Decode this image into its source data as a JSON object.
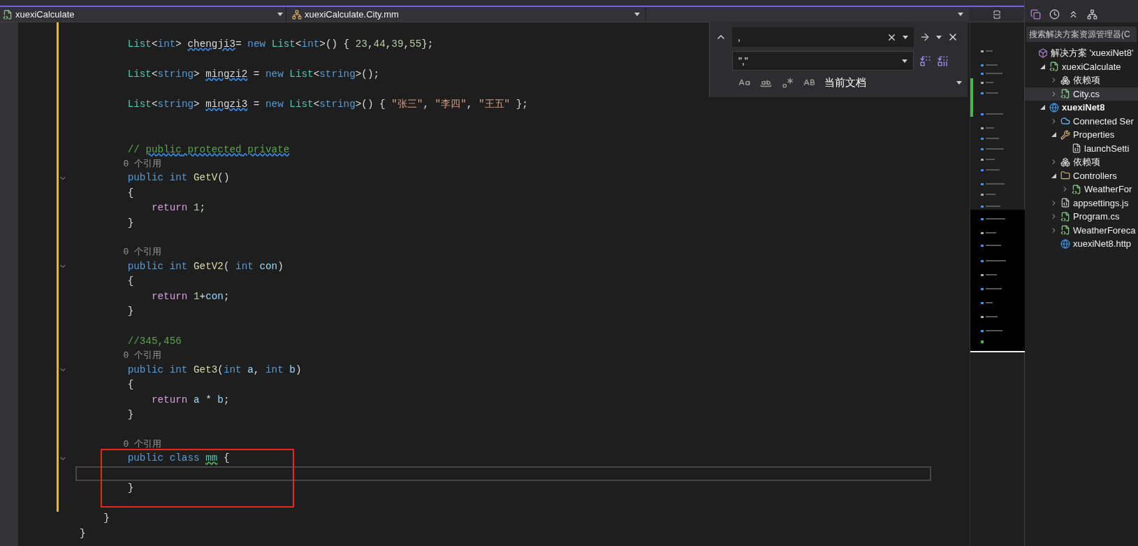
{
  "navigation_bar": {
    "project": "xuexiCalculate",
    "member": "xuexiCalculate.City.mm"
  },
  "find_widget": {
    "find_value": ",",
    "replace_value": "\",\"",
    "scope": "当前文档",
    "options": [
      {
        "kind": "match-case",
        "on": false
      },
      {
        "kind": "whole-word",
        "on": false
      },
      {
        "kind": "regex",
        "on": false
      },
      {
        "kind": "preserve-case",
        "on": false
      }
    ]
  },
  "editor": {
    "rows": [
      {
        "kind": "code",
        "tokens": [
          {
            "text": "        List",
            "kind": "type"
          },
          {
            "text": "<",
            "kind": "plain"
          },
          {
            "text": "int",
            "kind": "keyword"
          },
          {
            "text": "> ",
            "kind": "plain"
          },
          {
            "text": "chengji3",
            "kind": "plain-squiggle"
          },
          {
            "text": "= ",
            "kind": "plain"
          },
          {
            "text": "new ",
            "kind": "keyword"
          },
          {
            "text": "List",
            "kind": "type"
          },
          {
            "text": "<",
            "kind": "plain"
          },
          {
            "text": "int",
            "kind": "keyword"
          },
          {
            "text": ">() { ",
            "kind": "plain"
          },
          {
            "text": "23",
            "kind": "number"
          },
          {
            "text": ",",
            "kind": "plain"
          },
          {
            "text": "44",
            "kind": "number"
          },
          {
            "text": ",",
            "kind": "plain"
          },
          {
            "text": "39",
            "kind": "number"
          },
          {
            "text": ",",
            "kind": "plain"
          },
          {
            "text": "55",
            "kind": "number"
          },
          {
            "text": "};",
            "kind": "plain"
          }
        ]
      },
      {
        "kind": "blank"
      },
      {
        "kind": "code",
        "tokens": [
          {
            "text": "        List",
            "kind": "type"
          },
          {
            "text": "<",
            "kind": "plain"
          },
          {
            "text": "string",
            "kind": "keyword"
          },
          {
            "text": "> ",
            "kind": "plain"
          },
          {
            "text": "mingzi2",
            "kind": "plain-squiggle"
          },
          {
            "text": " = ",
            "kind": "plain"
          },
          {
            "text": "new ",
            "kind": "keyword"
          },
          {
            "text": "List",
            "kind": "type"
          },
          {
            "text": "<",
            "kind": "plain"
          },
          {
            "text": "string",
            "kind": "keyword"
          },
          {
            "text": ">();",
            "kind": "plain"
          }
        ]
      },
      {
        "kind": "blank"
      },
      {
        "kind": "code",
        "tokens": [
          {
            "text": "        List",
            "kind": "type"
          },
          {
            "text": "<",
            "kind": "plain"
          },
          {
            "text": "string",
            "kind": "keyword"
          },
          {
            "text": "> ",
            "kind": "plain"
          },
          {
            "text": "mingzi3",
            "kind": "plain-squiggle"
          },
          {
            "text": " = ",
            "kind": "plain"
          },
          {
            "text": "new ",
            "kind": "keyword"
          },
          {
            "text": "List",
            "kind": "type"
          },
          {
            "text": "<",
            "kind": "plain"
          },
          {
            "text": "string",
            "kind": "keyword"
          },
          {
            "text": ">() { ",
            "kind": "plain"
          },
          {
            "text": "\"张三\"",
            "kind": "string"
          },
          {
            "text": ", ",
            "kind": "plain"
          },
          {
            "text": "\"李四\"",
            "kind": "string"
          },
          {
            "text": ", ",
            "kind": "plain"
          },
          {
            "text": "\"王五\"",
            "kind": "string"
          },
          {
            "text": " };",
            "kind": "plain"
          }
        ]
      },
      {
        "kind": "blank"
      },
      {
        "kind": "blank"
      },
      {
        "kind": "code",
        "tokens": [
          {
            "text": "        // ",
            "kind": "comment"
          },
          {
            "text": "public",
            "kind": "comment-squiggle"
          },
          {
            "text": " protected",
            "kind": "comment-squiggle"
          },
          {
            "text": " private",
            "kind": "comment-squiggle"
          }
        ]
      },
      {
        "kind": "lens",
        "text": "        0 个引用"
      },
      {
        "kind": "fold",
        "tokens": [
          {
            "text": "        public int ",
            "kind": "keyword"
          },
          {
            "text": "GetV",
            "kind": "method"
          },
          {
            "text": "()",
            "kind": "plain"
          }
        ]
      },
      {
        "kind": "code",
        "tokens": [
          {
            "text": "        {",
            "kind": "plain"
          }
        ]
      },
      {
        "kind": "code",
        "tokens": [
          {
            "text": "            return ",
            "kind": "control"
          },
          {
            "text": "1",
            "kind": "number"
          },
          {
            "text": ";",
            "kind": "plain"
          }
        ]
      },
      {
        "kind": "code",
        "tokens": [
          {
            "text": "        }",
            "kind": "plain"
          }
        ]
      },
      {
        "kind": "blank"
      },
      {
        "kind": "lens",
        "text": "        0 个引用"
      },
      {
        "kind": "fold",
        "tokens": [
          {
            "text": "        public int ",
            "kind": "keyword"
          },
          {
            "text": "GetV2",
            "kind": "method"
          },
          {
            "text": "( ",
            "kind": "plain"
          },
          {
            "text": "int ",
            "kind": "keyword"
          },
          {
            "text": "con",
            "kind": "param"
          },
          {
            "text": ")",
            "kind": "plain"
          }
        ]
      },
      {
        "kind": "code",
        "tokens": [
          {
            "text": "        {",
            "kind": "plain"
          }
        ]
      },
      {
        "kind": "code",
        "tokens": [
          {
            "text": "            return ",
            "kind": "control"
          },
          {
            "text": "1",
            "kind": "number"
          },
          {
            "text": "+",
            "kind": "plain"
          },
          {
            "text": "con",
            "kind": "param"
          },
          {
            "text": ";",
            "kind": "plain"
          }
        ]
      },
      {
        "kind": "code",
        "tokens": [
          {
            "text": "        }",
            "kind": "plain"
          }
        ]
      },
      {
        "kind": "blank"
      },
      {
        "kind": "code",
        "tokens": [
          {
            "text": "        //345,456",
            "kind": "comment"
          }
        ]
      },
      {
        "kind": "lens",
        "text": "        0 个引用"
      },
      {
        "kind": "fold",
        "tokens": [
          {
            "text": "        public int ",
            "kind": "keyword"
          },
          {
            "text": "Get3",
            "kind": "method"
          },
          {
            "text": "(",
            "kind": "plain"
          },
          {
            "text": "int ",
            "kind": "keyword"
          },
          {
            "text": "a",
            "kind": "param"
          },
          {
            "text": ", ",
            "kind": "plain"
          },
          {
            "text": "int ",
            "kind": "keyword"
          },
          {
            "text": "b",
            "kind": "param"
          },
          {
            "text": ")",
            "kind": "plain"
          }
        ]
      },
      {
        "kind": "code",
        "tokens": [
          {
            "text": "        {",
            "kind": "plain"
          }
        ]
      },
      {
        "kind": "code",
        "tokens": [
          {
            "text": "            return ",
            "kind": "control"
          },
          {
            "text": "a",
            "kind": "param"
          },
          {
            "text": " * ",
            "kind": "plain"
          },
          {
            "text": "b",
            "kind": "param"
          },
          {
            "text": ";",
            "kind": "plain"
          }
        ]
      },
      {
        "kind": "code",
        "tokens": [
          {
            "text": "        }",
            "kind": "plain"
          }
        ]
      },
      {
        "kind": "blank"
      },
      {
        "kind": "lens",
        "text": "        0 个引用"
      },
      {
        "kind": "fold",
        "tokens": [
          {
            "text": "        public class ",
            "kind": "keyword"
          },
          {
            "text": "mm",
            "kind": "type-squiggle"
          },
          {
            "text": " {",
            "kind": "plain"
          }
        ]
      },
      {
        "kind": "current"
      },
      {
        "kind": "code",
        "tokens": [
          {
            "text": "        }",
            "kind": "plain"
          }
        ]
      },
      {
        "kind": "blank"
      },
      {
        "kind": "code",
        "tokens": [
          {
            "text": "    }",
            "kind": "plain"
          }
        ]
      },
      {
        "kind": "code",
        "tokens": [
          {
            "text": "}",
            "kind": "plain"
          }
        ]
      }
    ]
  },
  "solution_explorer": {
    "search": {
      "placeholder": "搜索解决方案资源管理器(C"
    },
    "tree": [
      {
        "label": "解决方案 'xuexiNet8'",
        "kind": "solution",
        "selected": false,
        "children": [
          {
            "label": "xuexiCalculate",
            "kind": "project",
            "expanded": true,
            "selected": false,
            "children": [
              {
                "label": "依赖项",
                "kind": "dependencies",
                "expanded": false,
                "selected": false
              },
              {
                "label": "City.cs",
                "kind": "csharp",
                "expanded": false,
                "selected": true
              }
            ]
          },
          {
            "label": "xuexiNet8",
            "kind": "web-project",
            "expanded": true,
            "selected": false,
            "children": [
              {
                "label": "Connected Ser",
                "kind": "connected",
                "expanded": false,
                "selected": false
              },
              {
                "label": "Properties",
                "kind": "properties",
                "expanded": true,
                "selected": false,
                "children": [
                  {
                    "label": "launchSetti",
                    "kind": "json",
                    "selected": false
                  }
                ]
              },
              {
                "label": "依赖项",
                "kind": "dependencies",
                "expanded": false,
                "selected": false
              },
              {
                "label": "Controllers",
                "kind": "folder",
                "expanded": true,
                "selected": false,
                "children": [
                  {
                    "label": "WeatherFor",
                    "kind": "csharp",
                    "expanded": false,
                    "selected": false
                  }
                ]
              },
              {
                "label": "appsettings.js",
                "kind": "json",
                "expanded": false,
                "selected": false
              },
              {
                "label": "Program.cs",
                "kind": "csharp",
                "expanded": false,
                "selected": false
              },
              {
                "label": "WeatherForeca",
                "kind": "csharp",
                "expanded": false,
                "selected": false
              },
              {
                "label": "xuexiNet8.http",
                "kind": "http",
                "selected": false
              }
            ]
          }
        ]
      }
    ]
  }
}
